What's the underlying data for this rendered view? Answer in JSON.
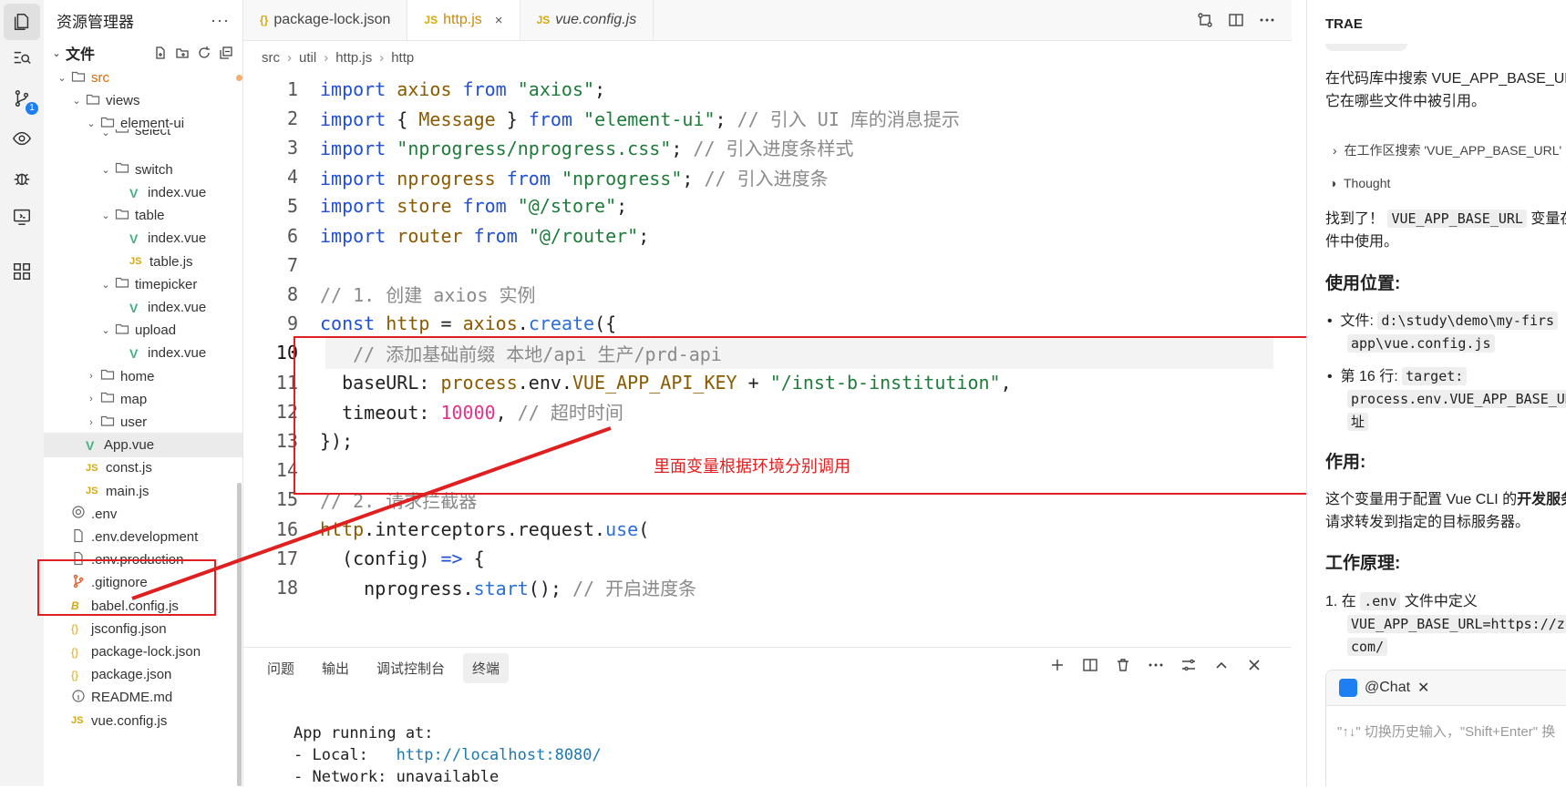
{
  "explorer": {
    "title": "资源管理器",
    "more": "···",
    "files_label": "文件",
    "tree": [
      {
        "label": "src",
        "depth": 1,
        "type": "folder-open",
        "color": "#e06a00"
      },
      {
        "label": "views",
        "depth": 2,
        "type": "folder-open"
      },
      {
        "label": "element-ui",
        "depth": 3,
        "type": "folder-open"
      },
      {
        "label": "select",
        "depth": 4,
        "type": "folder-cut"
      },
      {
        "label": "switch",
        "depth": 4,
        "type": "folder-open"
      },
      {
        "label": "index.vue",
        "depth": 5,
        "type": "vue"
      },
      {
        "label": "table",
        "depth": 4,
        "type": "folder-open"
      },
      {
        "label": "index.vue",
        "depth": 5,
        "type": "vue"
      },
      {
        "label": "table.js",
        "depth": 5,
        "type": "js"
      },
      {
        "label": "timepicker",
        "depth": 4,
        "type": "folder-open"
      },
      {
        "label": "index.vue",
        "depth": 5,
        "type": "vue"
      },
      {
        "label": "upload",
        "depth": 4,
        "type": "folder-open"
      },
      {
        "label": "index.vue",
        "depth": 5,
        "type": "vue"
      },
      {
        "label": "home",
        "depth": 3,
        "type": "folder"
      },
      {
        "label": "map",
        "depth": 3,
        "type": "folder"
      },
      {
        "label": "user",
        "depth": 3,
        "type": "folder"
      },
      {
        "label": "App.vue",
        "depth": 2,
        "type": "vue",
        "selected": true
      },
      {
        "label": "const.js",
        "depth": 2,
        "type": "js"
      },
      {
        "label": "main.js",
        "depth": 2,
        "type": "js"
      },
      {
        "label": ".env",
        "depth": 1,
        "type": "gear"
      },
      {
        "label": ".env.development",
        "depth": 1,
        "type": "file"
      },
      {
        "label": ".env.production",
        "depth": 1,
        "type": "file"
      },
      {
        "label": ".gitignore",
        "depth": 1,
        "type": "git"
      },
      {
        "label": "babel.config.js",
        "depth": 1,
        "type": "babel"
      },
      {
        "label": "jsconfig.json",
        "depth": 1,
        "type": "json"
      },
      {
        "label": "package-lock.json",
        "depth": 1,
        "type": "json"
      },
      {
        "label": "package.json",
        "depth": 1,
        "type": "json"
      },
      {
        "label": "README.md",
        "depth": 1,
        "type": "info"
      },
      {
        "label": "vue.config.js",
        "depth": 1,
        "type": "js"
      }
    ]
  },
  "activity": {
    "scm_badge": "1"
  },
  "editor": {
    "tabs": [
      {
        "label": "package-lock.json",
        "icon": "{}",
        "active": false
      },
      {
        "label": "http.js",
        "icon": "JS",
        "active": true,
        "close": "×"
      },
      {
        "label": "vue.config.js",
        "icon": "JS",
        "active": false
      }
    ],
    "breadcrumb": [
      "src",
      "util",
      "http.js",
      "http"
    ],
    "lines": [
      {
        "n": "1",
        "tokens": [
          [
            "kw",
            "import "
          ],
          [
            "id",
            "axios "
          ],
          [
            "kw",
            "from "
          ],
          [
            "str",
            "\"axios\""
          ],
          [
            "",
            "; "
          ]
        ]
      },
      {
        "n": "2",
        "tokens": [
          [
            "kw",
            "import "
          ],
          [
            "",
            "{ "
          ],
          [
            "id",
            "Message "
          ],
          [
            "",
            "} "
          ],
          [
            "kw",
            "from "
          ],
          [
            "str",
            "\"element-ui\""
          ],
          [
            "",
            "; "
          ],
          [
            "cm",
            "// 引入 UI 库的消息提示"
          ]
        ]
      },
      {
        "n": "3",
        "tokens": [
          [
            "kw",
            "import "
          ],
          [
            "str",
            "\"nprogress/nprogress.css\""
          ],
          [
            "",
            "; "
          ],
          [
            "cm",
            "// 引入进度条样式"
          ]
        ]
      },
      {
        "n": "4",
        "tokens": [
          [
            "kw",
            "import "
          ],
          [
            "id",
            "nprogress "
          ],
          [
            "kw",
            "from "
          ],
          [
            "str",
            "\"nprogress\""
          ],
          [
            "",
            "; "
          ],
          [
            "cm",
            "// 引入进度条"
          ]
        ]
      },
      {
        "n": "5",
        "tokens": [
          [
            "kw",
            "import "
          ],
          [
            "id",
            "store "
          ],
          [
            "kw",
            "from "
          ],
          [
            "str",
            "\"@/store\""
          ],
          [
            "",
            ";"
          ]
        ]
      },
      {
        "n": "6",
        "tokens": [
          [
            "kw",
            "import "
          ],
          [
            "id",
            "router "
          ],
          [
            "kw",
            "from "
          ],
          [
            "str",
            "\"@/router\""
          ],
          [
            "",
            ";"
          ]
        ]
      },
      {
        "n": "7",
        "tokens": []
      },
      {
        "n": "8",
        "tokens": [
          [
            "cm",
            "// 1. 创建 axios 实例"
          ]
        ]
      },
      {
        "n": "9",
        "tokens": [
          [
            "kw",
            "const "
          ],
          [
            "id",
            "http "
          ],
          [
            "",
            "= "
          ],
          [
            "id",
            "axios"
          ],
          [
            "",
            "."
          ],
          [
            "fn",
            "create"
          ],
          [
            "",
            "({"
          ]
        ]
      },
      {
        "n": "10",
        "tokens": [
          [
            "",
            "   "
          ],
          [
            "cm",
            "// 添加基础前缀 本地/api 生产/prd-api"
          ]
        ],
        "current": true
      },
      {
        "n": "11",
        "tokens": [
          [
            "",
            "  baseURL: "
          ],
          [
            "id",
            "process"
          ],
          [
            "",
            ".env."
          ],
          [
            "id",
            "VUE_APP_API_KEY "
          ],
          [
            "",
            "+ "
          ],
          [
            "str",
            "\"/inst-b-institution\""
          ],
          [
            "",
            ","
          ]
        ]
      },
      {
        "n": "12",
        "tokens": [
          [
            "",
            "  timeout: "
          ],
          [
            "num",
            "10000"
          ],
          [
            "",
            ", "
          ],
          [
            "cm",
            "// 超时时间"
          ]
        ]
      },
      {
        "n": "13",
        "tokens": [
          [
            "",
            "});"
          ]
        ]
      },
      {
        "n": "14",
        "tokens": []
      },
      {
        "n": "15",
        "tokens": [
          [
            "cm",
            "// 2. 请求拦截器"
          ]
        ]
      },
      {
        "n": "16",
        "tokens": [
          [
            "id",
            "http"
          ],
          [
            "",
            ".interceptors.request."
          ],
          [
            "fn",
            "use"
          ],
          [
            "",
            "("
          ]
        ]
      },
      {
        "n": "17",
        "tokens": [
          [
            "",
            "  (config) "
          ],
          [
            "kw",
            "=> "
          ],
          [
            "",
            "{"
          ]
        ]
      },
      {
        "n": "18",
        "tokens": [
          [
            "",
            "    nprogress."
          ],
          [
            "fn",
            "start"
          ],
          [
            "",
            "(); "
          ],
          [
            "cm",
            "// 开启进度条"
          ]
        ]
      }
    ],
    "annotation": "里面变量根据环境分别调用"
  },
  "panel": {
    "tabs": [
      "问题",
      "输出",
      "调试控制台",
      "终端"
    ],
    "active_tab": "终端",
    "terminal": {
      "line1": "App running at:",
      "local_label": "- Local:   ",
      "local_url": "http://localhost:8080/",
      "network_label": "- Network: ",
      "network_value": "unavailable"
    }
  },
  "assistant": {
    "title": "TRAE",
    "intro_1": "在代码库中搜索 VUE_APP_BASE_URL 变",
    "intro_2": "它在哪些文件中被引用。",
    "search_step": "在工作区搜索 'VUE_APP_BASE_URL'",
    "thought": "Thought",
    "found_1a": "找到了！",
    "found_code": "VUE_APP_BASE_URL",
    "found_1b": "变量在",
    "found_2": "件中使用。",
    "h_usage": "使用位置:",
    "file_label": "文件:",
    "file_path_1": "d:\\study\\demo\\my-firs",
    "file_path_2": "app\\vue.config.js",
    "line_label": "第 16 行:",
    "line_code_1": "target:",
    "line_code_2": "process.env.VUE_APP_BASE_UR",
    "line_code_3": "址",
    "h_effect": "作用:",
    "effect_1a": "这个变量用于配置 Vue CLI 的",
    "effect_1b": "开发服务器",
    "effect_2": "请求转发到指定的目标服务器。",
    "h_principle": "工作原理:",
    "step1_a": "1. 在",
    "step1_code": ".env",
    "step1_b": "文件中定义",
    "step1_code2": "VUE_APP_BASE_URL=https://z",
    "step1_code3": "com/",
    "chat_label": "@Chat",
    "chat_placeholder": "\"↑↓\" 切换历史输入，\"Shift+Enter\" 换"
  }
}
